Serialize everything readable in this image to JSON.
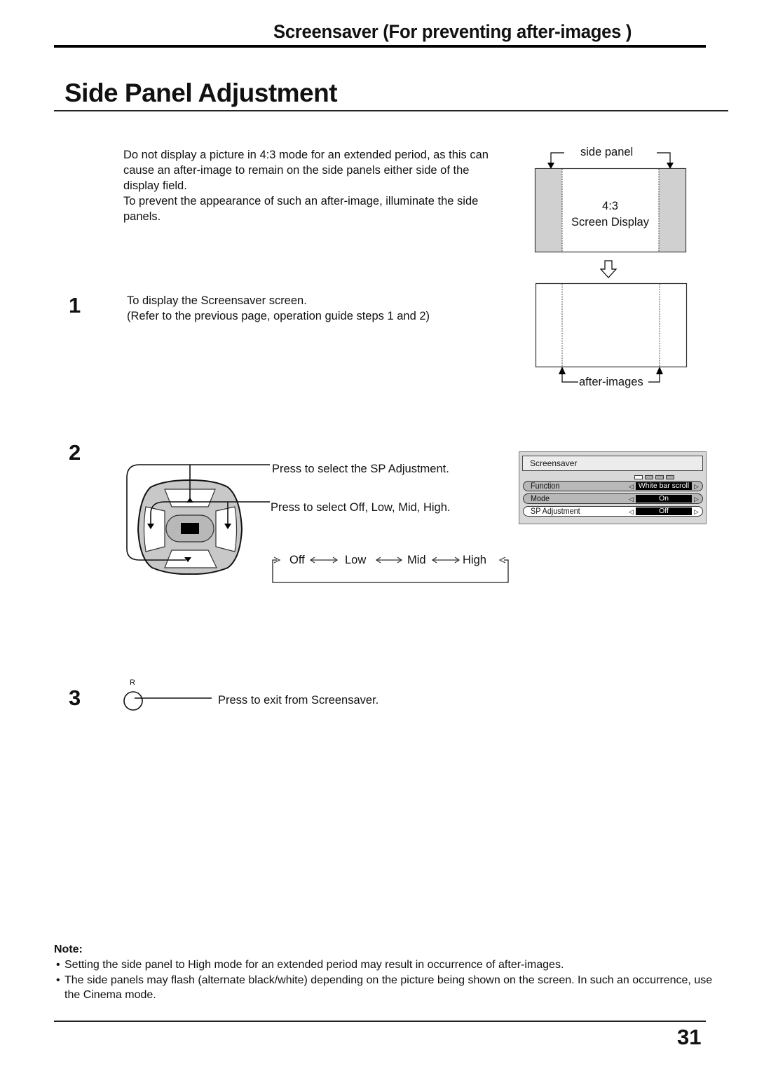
{
  "header": {
    "section_title": "Screensaver (For preventing after-images )",
    "page_title": "Side Panel Adjustment"
  },
  "intro": {
    "paragraph1": "Do not display a picture in 4:3 mode for an extended period, as this can cause an after-image to remain on the side panels either side of the display field.",
    "paragraph2": "To prevent the appearance of such an after-image, illuminate the side panels."
  },
  "diagram_top": {
    "side_panel_label": "side panel",
    "center_line1": "4:3",
    "center_line2": "Screen Display",
    "after_images_label": "after-images"
  },
  "steps": [
    {
      "number": "1",
      "line1": "To display the Screensaver screen.",
      "line2": "(Refer to the previous page, operation guide steps 1 and 2)"
    },
    {
      "number": "2",
      "updown_text": "Press to select the SP Adjustment.",
      "leftright_text": "Press to select Off, Low, Mid, High.",
      "cycle": [
        "Off",
        "Low",
        "Mid",
        "High"
      ]
    },
    {
      "number": "3",
      "button_label": "R",
      "text": "Press to exit from Screensaver."
    }
  ],
  "osd_menu": {
    "title": "Screensaver",
    "rows": [
      {
        "label": "Function",
        "value": "White bar scroll",
        "active": false
      },
      {
        "label": "Mode",
        "value": "On",
        "active": false
      },
      {
        "label": "SP Adjustment",
        "value": "Off",
        "active": true
      }
    ]
  },
  "note": {
    "label": "Note:",
    "items": [
      "Setting the side panel to High mode for an extended period may result in occurrence of after-images.",
      "The side panels may flash (alternate black/white) depending on the picture being shown on the screen. In such an occurrence, use the Cinema mode."
    ]
  },
  "footer": {
    "page_number": "31"
  }
}
